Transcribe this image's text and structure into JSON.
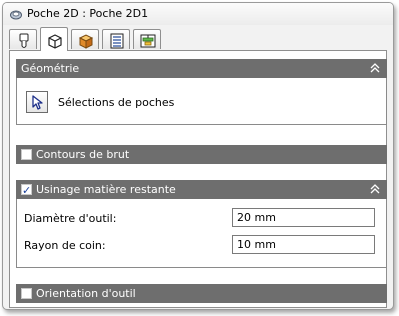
{
  "window": {
    "title": "Poche 2D : Poche 2D1"
  },
  "tabs": [
    {
      "icon": "tool-icon",
      "active": false
    },
    {
      "icon": "cube-outline-icon",
      "active": true
    },
    {
      "icon": "cube-solid-icon",
      "active": false
    },
    {
      "icon": "list-icon",
      "active": false
    },
    {
      "icon": "machining-icon",
      "active": false
    }
  ],
  "geometry": {
    "header": "Géométrie",
    "selection_label": "Sélections de poches"
  },
  "stock_contours": {
    "header": "Contours de brut",
    "checked": false
  },
  "rest_machining": {
    "header": "Usinage matière restante",
    "checked": true,
    "tool_diameter_label": "Diamètre d'outil:",
    "tool_diameter_value": "20 mm",
    "corner_radius_label": "Rayon de coin:",
    "corner_radius_value": "10 mm"
  },
  "tool_orientation": {
    "header": "Orientation d'outil",
    "checked": false
  },
  "colors": {
    "section_header": "#6e6e6e",
    "panel_background": "#f2f2f2",
    "check_color": "#1a3f9a"
  }
}
